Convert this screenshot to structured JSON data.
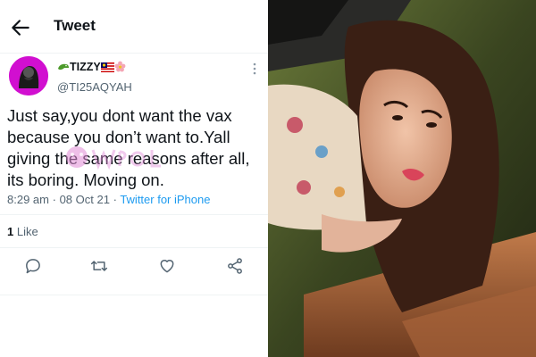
{
  "header": {
    "title": "Tweet"
  },
  "tweet": {
    "display_name": "TIZZY",
    "handle": "@TI25AQYAH",
    "text": "Just say,you dont want the vax because you don’t want to.Yall giving the same reasons after all, its boring. Moving on.",
    "time": "8:29 am",
    "date": "08 Oct 21",
    "separator": "·",
    "source": "Twitter for iPhone",
    "like_count": "1",
    "like_label": "Like"
  },
  "icons": {
    "back": "arrow-left-icon",
    "more": "more-vertical-icon",
    "reply": "reply-icon",
    "retweet": "retweet-icon",
    "like": "heart-icon",
    "share": "share-icon"
  },
  "colors": {
    "link": "#1d9bf0",
    "avatar_bg": "#d10fd0",
    "text": "#0f1419",
    "muted": "#536471"
  }
}
